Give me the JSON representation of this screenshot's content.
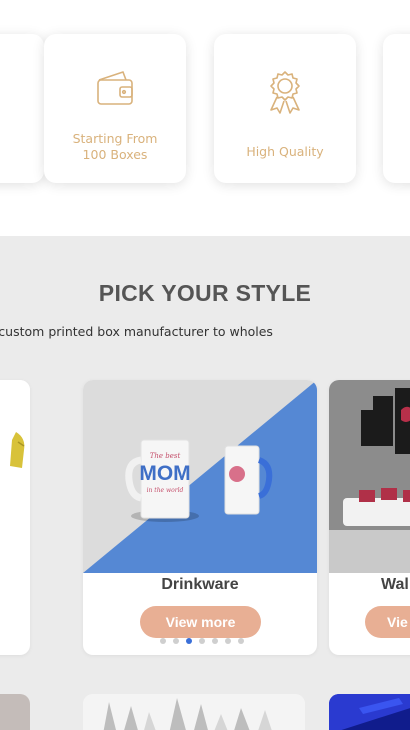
{
  "features": [
    {
      "icon": "wallet-icon",
      "text_line1": "Starting From",
      "text_line2": "100 Boxes"
    },
    {
      "icon": "award-ribbon-icon",
      "text_line1": "High Quality",
      "text_line2": ""
    }
  ],
  "section": {
    "title": "PICK YOUR STYLE",
    "subtitle": "mums, we're a leading custom printed box manufacturer to wholes"
  },
  "carousel": {
    "cards": [
      {
        "label": "Drinkware",
        "button": "View more"
      },
      {
        "label": "Wal",
        "button": "Vie"
      }
    ],
    "dots_count": 7,
    "active_dot": 2
  },
  "colors": {
    "accent": "#e8af94",
    "icon_gold": "#d9b27c",
    "active_dot": "#3a6fd8"
  }
}
